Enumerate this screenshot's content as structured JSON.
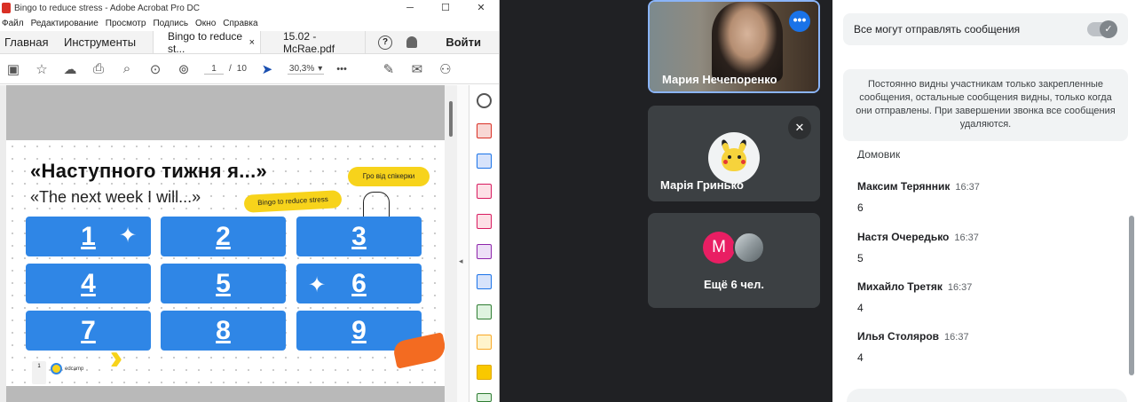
{
  "acrobat": {
    "window_title": "Bingo to reduce stress - Adobe Acrobat Pro DC",
    "win_minimize": "─",
    "win_maximize": "☐",
    "win_close": "✕",
    "menu": [
      "Файл",
      "Редактирование",
      "Просмотр",
      "Подпись",
      "Окно",
      "Справка"
    ],
    "tabs": {
      "home": "Главная",
      "tools": "Инструменты",
      "doc1": "Bingo to reduce st...",
      "doc1_close": "×",
      "doc2": "15.02 - McRae.pdf",
      "help": "?",
      "login": "Войти"
    },
    "toolbar": {
      "page_current": "1",
      "page_sep": "/",
      "page_total": "10",
      "zoom": "30,3%",
      "zoom_caret": "▾",
      "more": "•••"
    },
    "slide": {
      "title_ua": "«Наступного тижня я...»",
      "title_en": "«The next week I will...»",
      "pill_speakers": "Гро від спікерки",
      "pill_bingo": "Bingo to reduce stress",
      "cells": [
        "1",
        "2",
        "3",
        "4",
        "5",
        "6",
        "7",
        "8",
        "9"
      ],
      "logo_text": "edcamp",
      "page_thumb": "1"
    },
    "collapse_arrow": "◂"
  },
  "meet": {
    "self_name": "Мария Нечепоренко",
    "self_menu": "•••",
    "tile2_name": "Марія Гринько",
    "tile2_mute": "🎤",
    "tile3_avatar_letter": "M",
    "tile3_more": "Ещё 6 чел."
  },
  "chat": {
    "toggle_label": "Все могут отправлять сообщения",
    "toggle_check": "✓",
    "info": "Постоянно видны участникам только закрепленные сообщения, остальные сообщения видны, только когда они отправлены. При завершении звонка все сообщения удаляются.",
    "partial_text": "Домовик",
    "messages": [
      {
        "sender": "Максим Терянник",
        "time": "16:37",
        "text": "6"
      },
      {
        "sender": "Настя Очередько",
        "time": "16:37",
        "text": "5"
      },
      {
        "sender": "Михайло Третяк",
        "time": "16:37",
        "text": "4"
      },
      {
        "sender": "Илья Столяров",
        "time": "16:37",
        "text": "4"
      }
    ]
  }
}
